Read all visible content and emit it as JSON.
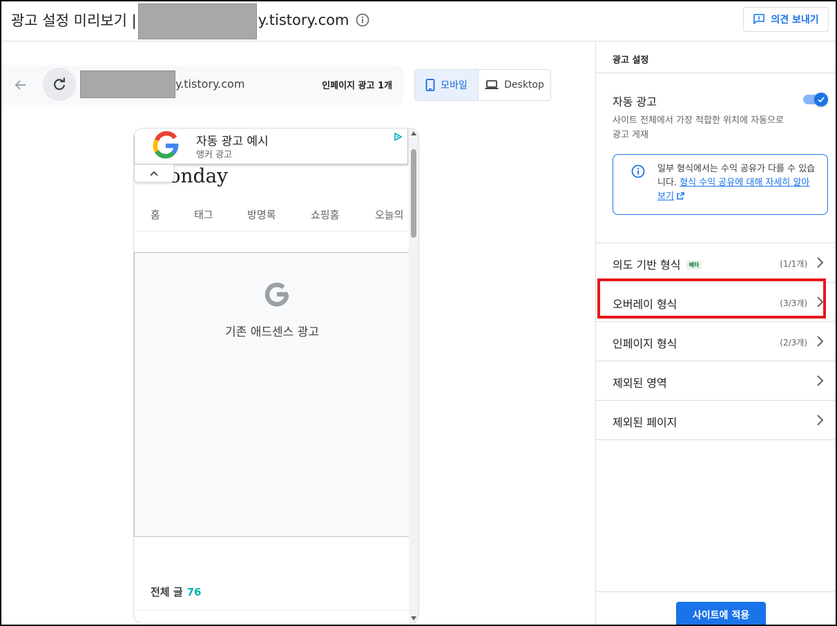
{
  "header": {
    "title_prefix": "광고 설정 미리보기 |",
    "title_domain_suffix": "y.tistory.com",
    "feedback_label": "의견 보내기"
  },
  "preview": {
    "url_suffix": "y.tistory.com",
    "inpage_ad_count": "인페이지 광고 1개",
    "device_mobile_label": "모바일",
    "device_desktop_label": "Desktop",
    "selected_device": "mobile"
  },
  "phone": {
    "anchor_ad": {
      "title": "자동 광고 예시",
      "subtitle": "앵커 광고"
    },
    "blog_title": "Monday",
    "nav_items": [
      "홈",
      "태그",
      "방명록",
      "쇼핑홈",
      "오늘의"
    ],
    "legacy_ad_label": "기존 애드센스 광고",
    "post_count_label": "전체 글",
    "post_count_value": "76"
  },
  "panel": {
    "title": "광고 설정",
    "auto_ads_label": "자동 광고",
    "auto_ads_enabled": true,
    "auto_ads_desc": "사이트 전체에서 가장 적합한 위치에 자동으로 광고 게재",
    "info_text": "일부 형식에서는 수익 공유가 다를 수 있습니다.",
    "info_link": "형식 수익 공유에 대해 자세히 알아보기",
    "sections": [
      {
        "label": "의도 기반 형식",
        "badge": "베타",
        "count": "(1/1개)"
      },
      {
        "label": "오버레이 형식",
        "badge": "",
        "count": "(3/3개)"
      },
      {
        "label": "인페이지 형식",
        "badge": "",
        "count": "(2/3개)"
      },
      {
        "label": "제외된 영역",
        "badge": "",
        "count": ""
      },
      {
        "label": "제외된 페이지",
        "badge": "",
        "count": ""
      }
    ],
    "apply_label": "사이트에 적용"
  },
  "colors": {
    "accent": "#1a73e8",
    "highlight": "#e8161a",
    "post_count": "#00b5ad"
  }
}
